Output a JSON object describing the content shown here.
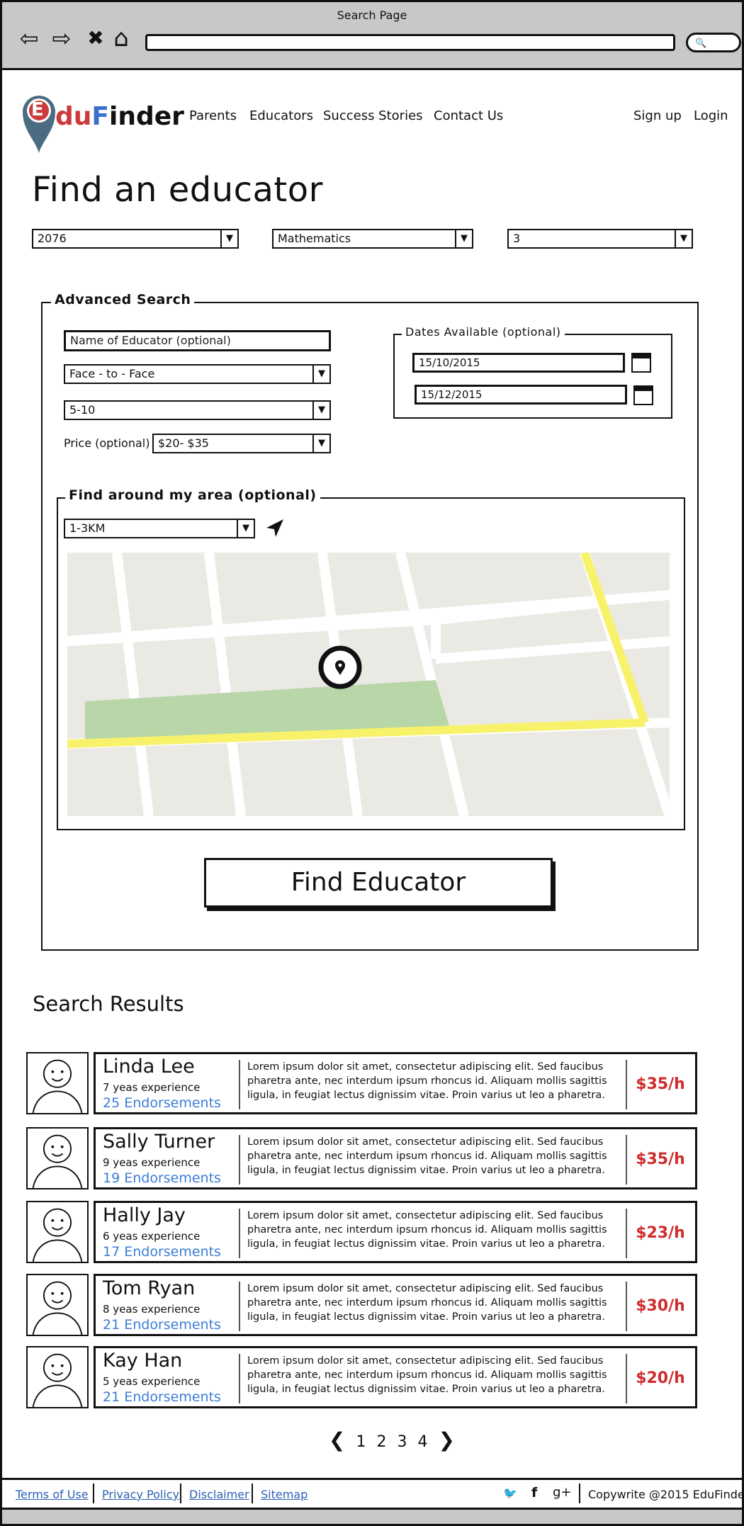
{
  "window": {
    "title": "Search Page",
    "back_glyph": "⇦",
    "forward_glyph": "⇨",
    "stop_glyph": "✖",
    "home_glyph": "⌂",
    "search_glyph": "🔍"
  },
  "brand": {
    "name_prefix": "du",
    "name_f": "F",
    "name_suffix": "inder",
    "logo_letter": "E",
    "colors": {
      "e": "#cc3b3b",
      "f": "#3b6fcc",
      "pin": "#4a6b80"
    }
  },
  "nav": {
    "links": [
      "Parents",
      "Educators",
      "Success Stories",
      "Contact Us"
    ],
    "sign_up": "Sign up",
    "login": "Login"
  },
  "page": {
    "title": "Find an educator"
  },
  "filters": {
    "postcode": "2076",
    "subject": "Mathematics",
    "grade": "3"
  },
  "advanced": {
    "legend": "Advanced Search",
    "name_placeholder": "Name of Educator (optional)",
    "mode": "Face - to - Face",
    "age_range": "5-10",
    "price_label": "Price (optional)",
    "price": "$20- $35",
    "dates_legend": "Dates Available (optional)",
    "date_from": "15/10/2015",
    "date_to": "15/12/2015",
    "area_legend": "Find around my area (optional)",
    "radius": "1-3KM",
    "find_button": "Find Educator"
  },
  "map_colors": {
    "base": "#ebe9e4",
    "road": "#ffffff",
    "major_road": "#f7f26a",
    "park": "#b9d6a9",
    "pin": "#111111"
  },
  "results": {
    "title": "Search Results",
    "items": [
      {
        "name": "Linda Lee",
        "experience": "7 yeas experience",
        "endorsements": "25 Endorsements",
        "price": "$35/h",
        "description": "Lorem ipsum dolor sit amet, consectetur adipiscing elit. Sed faucibus pharetra ante, nec interdum ipsum rhoncus id. Aliquam mollis sagittis ligula, in feugiat lectus dignissim vitae. Proin varius ut leo a pharetra."
      },
      {
        "name": "Sally Turner",
        "experience": "9 yeas experience",
        "endorsements": "19 Endorsements",
        "price": "$35/h",
        "description": "Lorem ipsum dolor sit amet, consectetur adipiscing elit. Sed faucibus pharetra ante, nec interdum ipsum rhoncus id. Aliquam mollis sagittis ligula, in feugiat lectus dignissim vitae. Proin varius ut leo a pharetra."
      },
      {
        "name": "Hally Jay",
        "experience": "6 yeas experience",
        "endorsements": "17 Endorsements",
        "price": "$23/h",
        "description": "Lorem ipsum dolor sit amet, consectetur adipiscing elit. Sed faucibus pharetra ante, nec interdum ipsum rhoncus id. Aliquam mollis sagittis ligula, in feugiat lectus dignissim vitae. Proin varius ut leo a pharetra."
      },
      {
        "name": "Tom Ryan",
        "experience": "8 yeas experience",
        "endorsements": "21 Endorsements",
        "price": "$30/h",
        "description": "Lorem ipsum dolor sit amet, consectetur adipiscing elit. Sed faucibus pharetra ante, nec interdum ipsum rhoncus id. Aliquam mollis sagittis ligula, in feugiat lectus dignissim vitae. Proin varius ut leo a pharetra."
      },
      {
        "name": "Kay Han",
        "experience": "5 yeas experience",
        "endorsements": "21 Endorsements",
        "price": "$20/h",
        "description": "Lorem ipsum dolor sit amet, consectetur adipiscing elit. Sed faucibus pharetra ante, nec interdum ipsum rhoncus id. Aliquam mollis sagittis ligula, in feugiat lectus dignissim vitae. Proin varius ut leo a pharetra."
      }
    ],
    "price_color": "#d02c2c",
    "endorsement_color": "#3b7dd8"
  },
  "pagination": {
    "prev": "❮",
    "pages": [
      "1",
      "2",
      "3",
      "4"
    ],
    "next": "❯"
  },
  "footer": {
    "links": [
      "Terms of Use",
      "Privacy Policy",
      "Disclaimer",
      "Sitemap"
    ],
    "social": {
      "twitter": "🐦",
      "facebook": "f",
      "google_plus": "g+"
    },
    "copyright": "Copywrite @2015 EduFinder"
  },
  "icons": [
    "back-icon",
    "forward-icon",
    "stop-icon",
    "home-icon",
    "search-icon",
    "calendar-icon",
    "locate-arrow-icon",
    "map-pin-icon",
    "avatar-icon",
    "twitter-icon",
    "facebook-icon",
    "google-plus-icon"
  ]
}
